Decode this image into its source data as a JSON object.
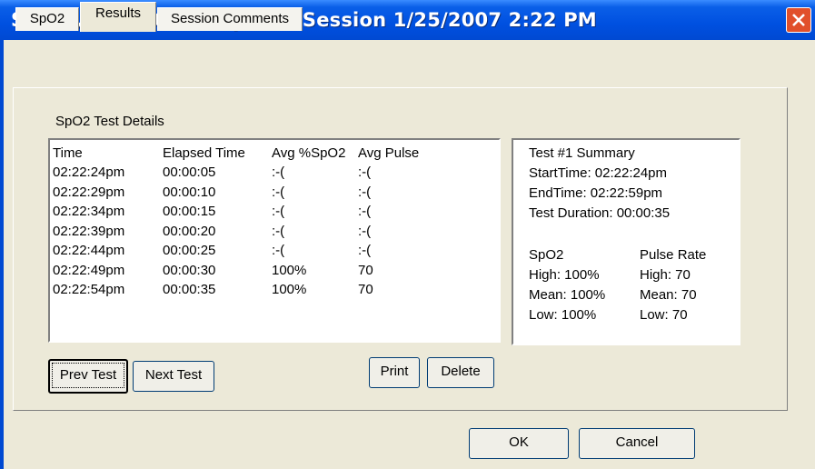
{
  "window": {
    "title": "Smith, John Oximetry Test Session 1/25/2007 2:22 PM"
  },
  "tabs": [
    {
      "label": "SpO2",
      "active": false
    },
    {
      "label": "Results",
      "active": true
    },
    {
      "label": "Session Comments",
      "active": false
    }
  ],
  "details": {
    "heading": "SpO2 Test Details",
    "columns": [
      "Time",
      "Elapsed Time",
      "Avg %SpO2",
      "Avg Pulse"
    ],
    "rows": [
      [
        "02:22:24pm",
        "00:00:05",
        ":-(",
        ":-("
      ],
      [
        "02:22:29pm",
        "00:00:10",
        ":-(",
        ":-("
      ],
      [
        "02:22:34pm",
        "00:00:15",
        ":-(",
        ":-("
      ],
      [
        "02:22:39pm",
        "00:00:20",
        ":-(",
        ":-("
      ],
      [
        "02:22:44pm",
        "00:00:25",
        ":-(",
        ":-("
      ],
      [
        "02:22:49pm",
        "00:00:30",
        "100%",
        "70"
      ],
      [
        "02:22:54pm",
        "00:00:35",
        "100%",
        "70"
      ]
    ]
  },
  "summary": {
    "title": "Test #1 Summary",
    "start": "StartTime: 02:22:24pm",
    "end": "EndTime: 02:22:59pm",
    "duration": "Test Duration: 00:00:35",
    "spo2_header": "SpO2",
    "pulse_header": "Pulse Rate",
    "spo2_high": "High:  100%",
    "spo2_mean": "Mean: 100%",
    "spo2_low": "Low:  100%",
    "pulse_high": "High:  70",
    "pulse_mean": "Mean: 70",
    "pulse_low": "Low:  70"
  },
  "buttons": {
    "prev": "Prev Test",
    "next": "Next Test",
    "print": "Print",
    "delete": "Delete",
    "ok": "OK",
    "cancel": "Cancel"
  },
  "colors": {
    "titlebar": "#0054E3",
    "face": "#ECE9D8",
    "close": "#E1502B"
  }
}
